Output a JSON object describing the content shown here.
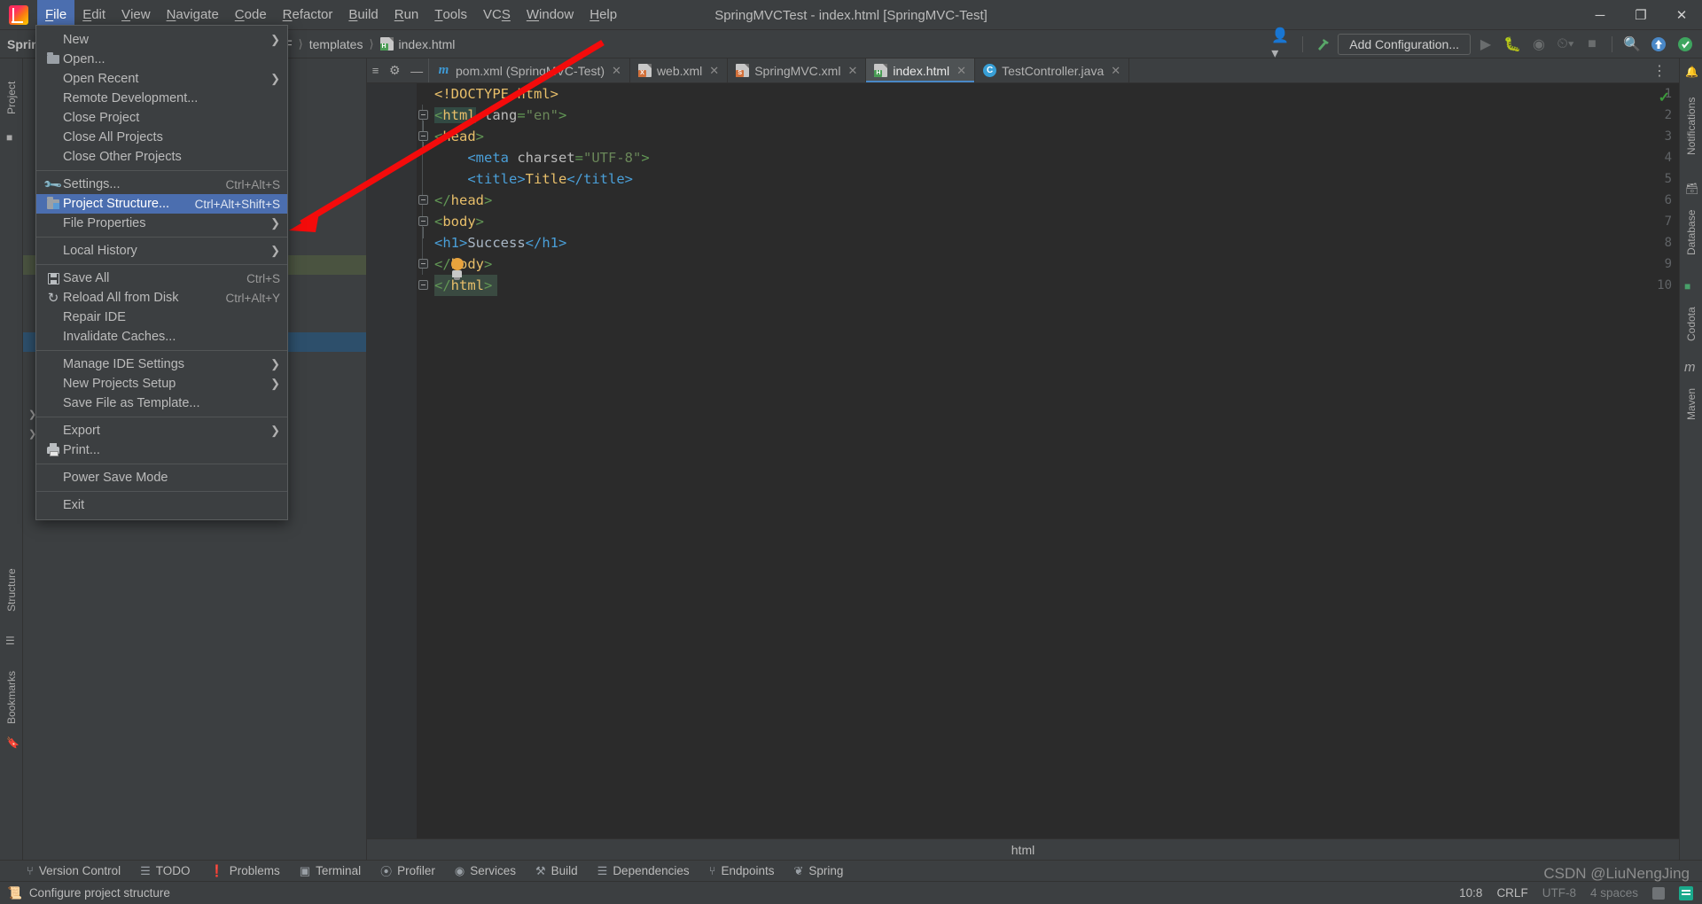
{
  "window": {
    "title": "SpringMVCTest - index.html [SpringMVC-Test]",
    "minimize_glyph": "─",
    "maximize_glyph": "❐",
    "close_glyph": "✕",
    "logo_name": "intellij-idea-logo"
  },
  "menubar": [
    {
      "label": "File",
      "mnemonic": "F",
      "active": true
    },
    {
      "label": "Edit",
      "mnemonic": "E",
      "active": false
    },
    {
      "label": "View",
      "mnemonic": "V",
      "active": false
    },
    {
      "label": "Navigate",
      "mnemonic": "N",
      "active": false
    },
    {
      "label": "Code",
      "mnemonic": "C",
      "active": false
    },
    {
      "label": "Refactor",
      "mnemonic": "R",
      "active": false
    },
    {
      "label": "Build",
      "mnemonic": "B",
      "active": false
    },
    {
      "label": "Run",
      "mnemonic": "R",
      "active": false
    },
    {
      "label": "Tools",
      "mnemonic": "T",
      "active": false
    },
    {
      "label": "VCS",
      "mnemonic": "S",
      "active": false
    },
    {
      "label": "Window",
      "mnemonic": "W",
      "active": false
    },
    {
      "label": "Help",
      "mnemonic": "H",
      "active": false
    }
  ],
  "file_menu": [
    {
      "label": "New",
      "shortcut": "",
      "icon": "",
      "submenu": true,
      "selected": false
    },
    {
      "label": "Open...",
      "shortcut": "",
      "icon": "folder-icon",
      "submenu": false,
      "selected": false
    },
    {
      "label": "Open Recent",
      "shortcut": "",
      "icon": "",
      "submenu": true,
      "selected": false
    },
    {
      "label": "Remote Development...",
      "shortcut": "",
      "icon": "",
      "submenu": false,
      "selected": false
    },
    {
      "label": "Close Project",
      "shortcut": "",
      "icon": "",
      "submenu": false,
      "selected": false
    },
    {
      "label": "Close All Projects",
      "shortcut": "",
      "icon": "",
      "submenu": false,
      "selected": false
    },
    {
      "label": "Close Other Projects",
      "shortcut": "",
      "icon": "",
      "submenu": false,
      "selected": false
    },
    {
      "separator": true
    },
    {
      "label": "Settings...",
      "shortcut": "Ctrl+Alt+S",
      "icon": "wrench-icon",
      "submenu": false,
      "selected": false
    },
    {
      "label": "Project Structure...",
      "shortcut": "Ctrl+Alt+Shift+S",
      "icon": "project-structure-icon",
      "submenu": false,
      "selected": true
    },
    {
      "label": "File Properties",
      "shortcut": "",
      "icon": "",
      "submenu": true,
      "selected": false
    },
    {
      "separator": true
    },
    {
      "label": "Local History",
      "shortcut": "",
      "icon": "",
      "submenu": true,
      "selected": false
    },
    {
      "separator": true
    },
    {
      "label": "Save All",
      "shortcut": "Ctrl+S",
      "icon": "save-icon",
      "submenu": false,
      "selected": false
    },
    {
      "label": "Reload All from Disk",
      "shortcut": "Ctrl+Alt+Y",
      "icon": "reload-icon",
      "submenu": false,
      "selected": false
    },
    {
      "label": "Repair IDE",
      "shortcut": "",
      "icon": "",
      "submenu": false,
      "selected": false
    },
    {
      "label": "Invalidate Caches...",
      "shortcut": "",
      "icon": "",
      "submenu": false,
      "selected": false
    },
    {
      "separator": true
    },
    {
      "label": "Manage IDE Settings",
      "shortcut": "",
      "icon": "",
      "submenu": true,
      "selected": false
    },
    {
      "label": "New Projects Setup",
      "shortcut": "",
      "icon": "",
      "submenu": true,
      "selected": false
    },
    {
      "label": "Save File as Template...",
      "shortcut": "",
      "icon": "",
      "submenu": false,
      "selected": false
    },
    {
      "separator": true
    },
    {
      "label": "Export",
      "shortcut": "",
      "icon": "",
      "submenu": true,
      "selected": false
    },
    {
      "label": "Print...",
      "shortcut": "",
      "icon": "print-icon",
      "submenu": false,
      "selected": false
    },
    {
      "separator": true
    },
    {
      "label": "Power Save Mode",
      "shortcut": "",
      "icon": "",
      "submenu": false,
      "selected": false
    },
    {
      "separator": true
    },
    {
      "label": "Exit",
      "shortcut": "",
      "icon": "",
      "submenu": false,
      "selected": false
    }
  ],
  "navbar": {
    "project_label": "Sprin",
    "crumb_partial": "lF",
    "crumb_templates": "templates",
    "crumb_file": "index.html",
    "add_configuration": "Add Configuration...",
    "icons": [
      "user-dropdown-icon",
      "hammer-build-icon",
      "run-icon",
      "debug-icon",
      "run-coverage-icon",
      "profile-icon",
      "stop-icon",
      "search-icon",
      "update-icon",
      "ide-assistant-icon"
    ]
  },
  "left_stripe": {
    "project_label": "Project",
    "structure_label": "Structure",
    "bookmarks_label": "Bookmarks"
  },
  "right_stripe": {
    "notifications_label": "Notifications",
    "database_label": "Database",
    "codota_label": "Codota",
    "maven_label": "Maven"
  },
  "editor_tabs": [
    {
      "label": "pom.xml (SpringMVC-Test)",
      "icon": "maven-file-icon",
      "active": false,
      "close_glyph": "✕"
    },
    {
      "label": "web.xml",
      "icon": "xml-file-icon",
      "active": false,
      "close_glyph": "✕"
    },
    {
      "label": "SpringMVC.xml",
      "icon": "spring-xml-file-icon",
      "active": false,
      "close_glyph": "✕"
    },
    {
      "label": "index.html",
      "icon": "html-file-icon",
      "active": true,
      "close_glyph": "✕"
    },
    {
      "label": "TestController.java",
      "icon": "java-class-icon",
      "active": false,
      "close_glyph": "✕"
    }
  ],
  "code": {
    "lines": [
      {
        "no": "1",
        "text": "<!DOCTYPE html>"
      },
      {
        "no": "2",
        "text": "<html lang=\"en\">"
      },
      {
        "no": "3",
        "text": "<head>"
      },
      {
        "no": "4",
        "text": "    <meta charset=\"UTF-8\">"
      },
      {
        "no": "5",
        "text": "    <title>Title</title>"
      },
      {
        "no": "6",
        "text": "</head>"
      },
      {
        "no": "7",
        "text": "<body>"
      },
      {
        "no": "8",
        "text": "<h1>Success</h1>"
      },
      {
        "no": "9",
        "text": "</body>"
      },
      {
        "no": "10",
        "text": "</html>"
      }
    ],
    "bottom_breadcrumb": "html",
    "inspection_status": "✓"
  },
  "bottom_tools": [
    {
      "label": "Version Control",
      "icon": "branch-icon"
    },
    {
      "label": "TODO",
      "icon": "list-icon"
    },
    {
      "label": "Problems",
      "icon": "warning-icon"
    },
    {
      "label": "Terminal",
      "icon": "terminal-icon"
    },
    {
      "label": "Profiler",
      "icon": "profiler-icon"
    },
    {
      "label": "Services",
      "icon": "services-icon"
    },
    {
      "label": "Build",
      "icon": "hammer-icon"
    },
    {
      "label": "Dependencies",
      "icon": "layers-icon"
    },
    {
      "label": "Endpoints",
      "icon": "endpoints-icon"
    },
    {
      "label": "Spring",
      "icon": "spring-leaf-icon"
    }
  ],
  "statusbar": {
    "message": "Configure project structure",
    "message_icon": "info-icon",
    "caret_position": "10:8",
    "line_separator": "CRLF",
    "encoding": "UTF-8",
    "indent": "4 spaces",
    "lock_icon": "read-only-icon",
    "assistant_icon": "ide-assistant-badge"
  },
  "watermark": "CSDN @LiuNengJing",
  "colors": {
    "accent_blue": "#4b6eaf",
    "tab_active": "#4e5254",
    "editor_bg": "#2b2b2b",
    "panel_bg": "#3c3f41",
    "arrow_red": "#f40b0b",
    "tag_yellow": "#e8bf6a",
    "bracket_green": "#629755",
    "string_green": "#6a8759",
    "blue_tag": "#4a9fd8"
  }
}
